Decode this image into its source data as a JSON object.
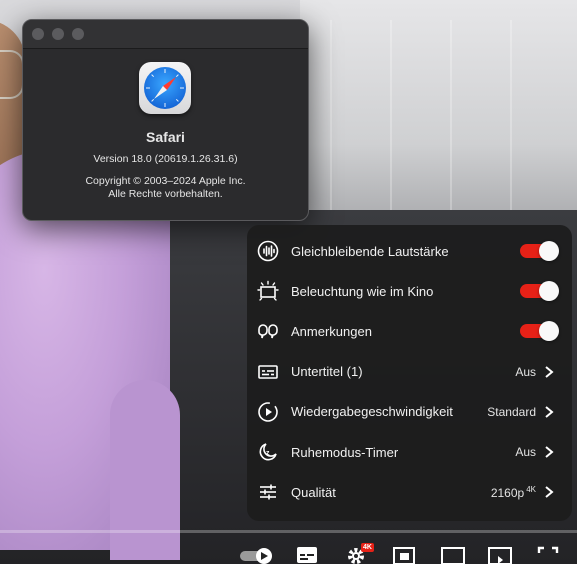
{
  "about_window": {
    "app_name": "Safari",
    "version": "Version 18.0 (20619.1.26.31.6)",
    "copyright_line1": "Copyright © 2003–2024 Apple Inc.",
    "copyright_line2": "Alle Rechte vorbehalten.",
    "icon": "safari-compass-icon"
  },
  "settings_menu": {
    "items": [
      {
        "label": "Gleichbleibende Lautstärke",
        "icon": "stable-volume-icon",
        "toggle": true,
        "enabled": true
      },
      {
        "label": "Beleuchtung wie im Kino",
        "icon": "ambient-mode-icon",
        "toggle": true,
        "enabled": true
      },
      {
        "label": "Anmerkungen",
        "icon": "annotations-icon",
        "toggle": true,
        "enabled": true
      },
      {
        "label": "Untertitel (1)",
        "icon": "subtitles-icon",
        "value": "Aus"
      },
      {
        "label": "Wiedergabegeschwindigkeit",
        "icon": "playback-speed-icon",
        "value": "Standard"
      },
      {
        "label": "Ruhemodus-Timer",
        "icon": "sleep-timer-icon",
        "value": "Aus"
      },
      {
        "label": "Qualität",
        "icon": "quality-icon",
        "value": "2160p",
        "value_badge": "4K"
      }
    ]
  },
  "player_controls": {
    "settings_badge": "4K",
    "icons": [
      "autoplay-toggle-icon",
      "subtitles-icon",
      "settings-gear-icon",
      "miniplayer-icon",
      "theater-mode-icon",
      "cast-icon",
      "fullscreen-icon"
    ]
  },
  "colors": {
    "toggle_on": "#e62117",
    "panel_bg": "#1c1c1c",
    "badge": "#e62117"
  }
}
